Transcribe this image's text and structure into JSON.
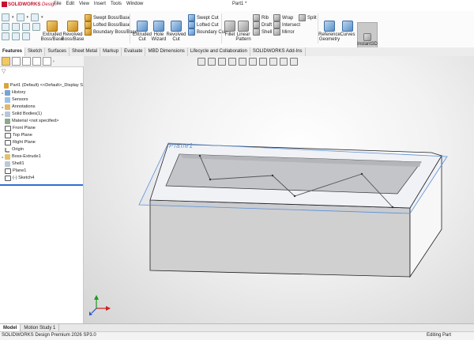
{
  "app": {
    "logo_brand": "SOLIDWORKS",
    "logo_sub": "Design",
    "doc_title": "Part1 *"
  },
  "menu": [
    "File",
    "Edit",
    "View",
    "Insert",
    "Tools",
    "Window"
  ],
  "ribbon": {
    "extruded_boss": "Extruded Boss/Base",
    "revolved_boss": "Revolved Boss/Base",
    "swept_boss": "Swept Boss/Base",
    "lofted_boss": "Lofted Boss/Base",
    "boundary_boss": "Boundary Boss/Base",
    "extruded_cut": "Extruded Cut",
    "hole_wizard": "Hole Wizard",
    "revolved_cut": "Revolved Cut",
    "swept_cut": "Swept Cut",
    "lofted_cut": "Lofted Cut",
    "boundary_cut": "Boundary Cut",
    "fillet": "Fillet",
    "linear_pattern": "Linear Pattern",
    "rib": "Rib",
    "draft": "Draft",
    "shell": "Shell",
    "wrap": "Wrap",
    "intersect": "Intersect",
    "mirror": "Mirror",
    "split": "Split",
    "reference_geometry": "Reference Geometry",
    "curves": "Curves",
    "instant3d": "Instant3D"
  },
  "tabs": [
    "Features",
    "Sketch",
    "Surfaces",
    "Sheet Metal",
    "Markup",
    "Evaluate",
    "MBD Dimensions",
    "Lifecycle and Collaboration",
    "SOLIDWORKS Add-Ins"
  ],
  "tree": {
    "root": "Part1 (Default) <<Default>_Display S",
    "items": [
      "History",
      "Sensors",
      "Annotations",
      "Solid Bodies(1)",
      "Material <not specified>",
      "Front Plane",
      "Top Plane",
      "Right Plane",
      "Origin",
      "Boss-Extrude1",
      "Shell1",
      "Plane1",
      "(-) Sketch4"
    ]
  },
  "viewport": {
    "plane_label": "Plane1"
  },
  "bottom_tabs": [
    "Model",
    "Motion Study 1"
  ],
  "status": {
    "left": "SOLIDWORKS Design Premium 2026 SP3.0",
    "right": "Editing Part"
  },
  "colors": {
    "brand_red": "#c8102e",
    "plane_blue": "#5b8fd8",
    "rollback_blue": "#2f6fd0"
  }
}
